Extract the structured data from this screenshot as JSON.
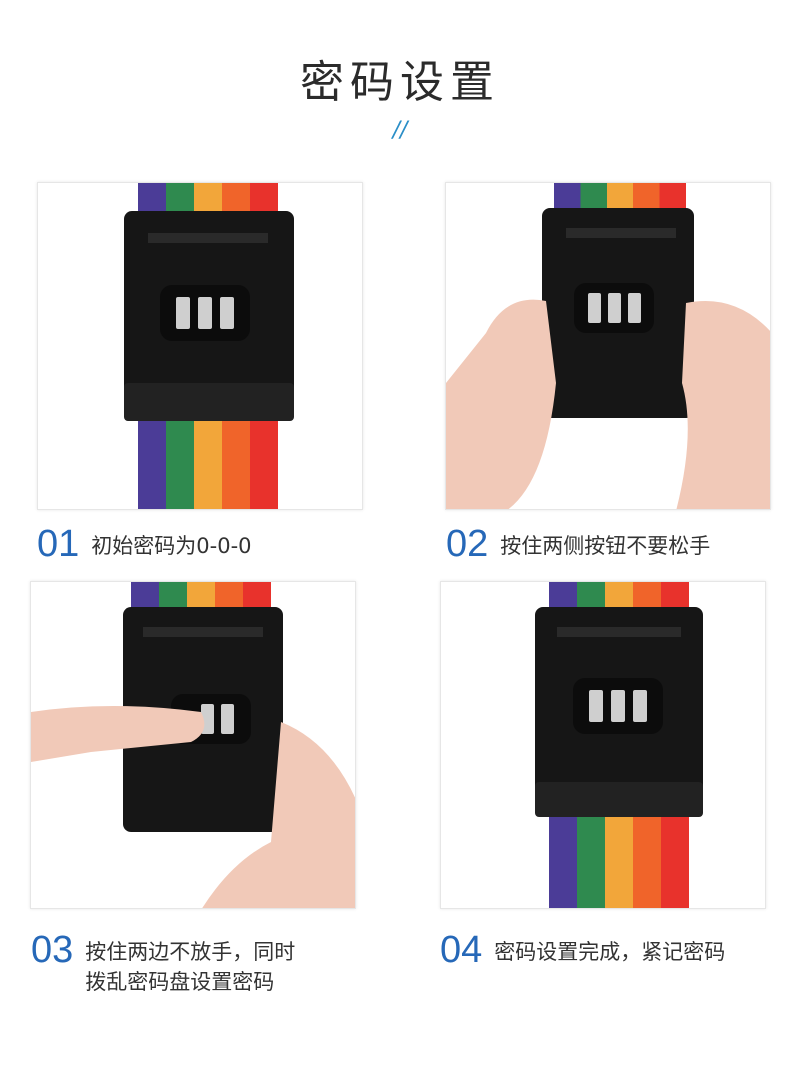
{
  "title": "密码设置",
  "title_mark": "//",
  "steps": [
    {
      "number": "01",
      "lines": [
        "初始密码为0-0-0"
      ]
    },
    {
      "number": "02",
      "lines": [
        "按住两侧按钮不要松手"
      ]
    },
    {
      "number": "03",
      "lines": [
        "按住两边不放手，同时",
        "拨乱密码盘设置密码"
      ]
    },
    {
      "number": "04",
      "lines": [
        "密码设置完成，紧记密码"
      ]
    }
  ],
  "colors": {
    "accent": "#2668b8",
    "mark": "#2a8ec7",
    "strap": [
      "#4b3c97",
      "#2f8a4f",
      "#f2a63a",
      "#f0642a",
      "#e8322c"
    ]
  }
}
